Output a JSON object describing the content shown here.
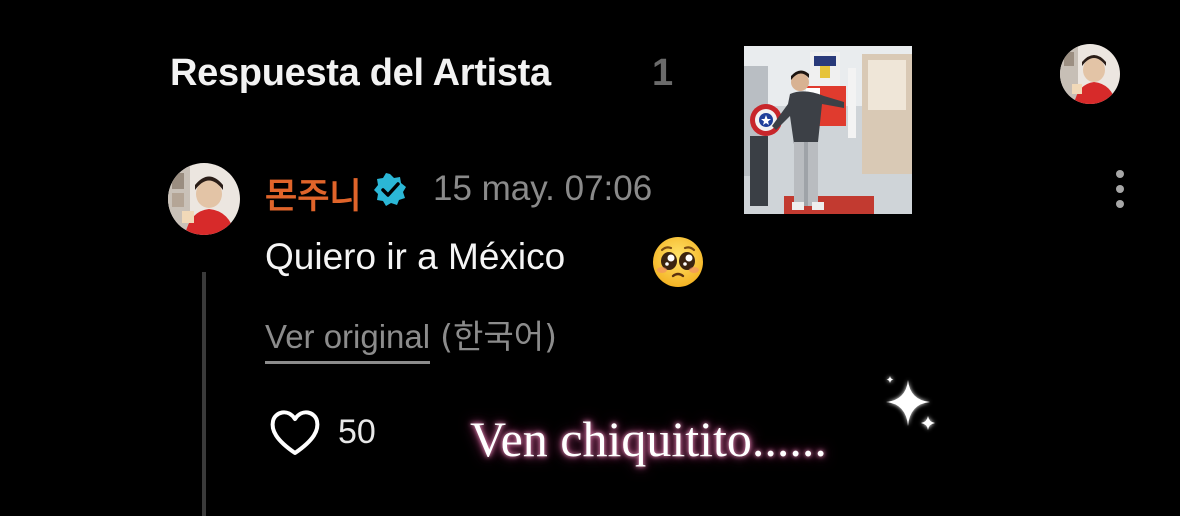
{
  "header": {
    "title": "Respuesta del Artista",
    "count": "1"
  },
  "comment": {
    "author": "몬주니",
    "verified_icon": "verified-badge-icon",
    "timestamp": "15 may. 07:06",
    "text": "Quiero ir a México",
    "emoji": "pleading-face-icon",
    "see_original_label": "Ver original",
    "original_language": "(한국어)",
    "likes": "50"
  },
  "overlay": {
    "caption": "Ven chiquitito......",
    "sparkle_icon": "sparkle-icon"
  },
  "colors": {
    "background": "#000000",
    "author": "#e0642a",
    "verified": "#2bb7d6",
    "muted": "#8a8a8a",
    "caption_glow": "#b0487c"
  }
}
